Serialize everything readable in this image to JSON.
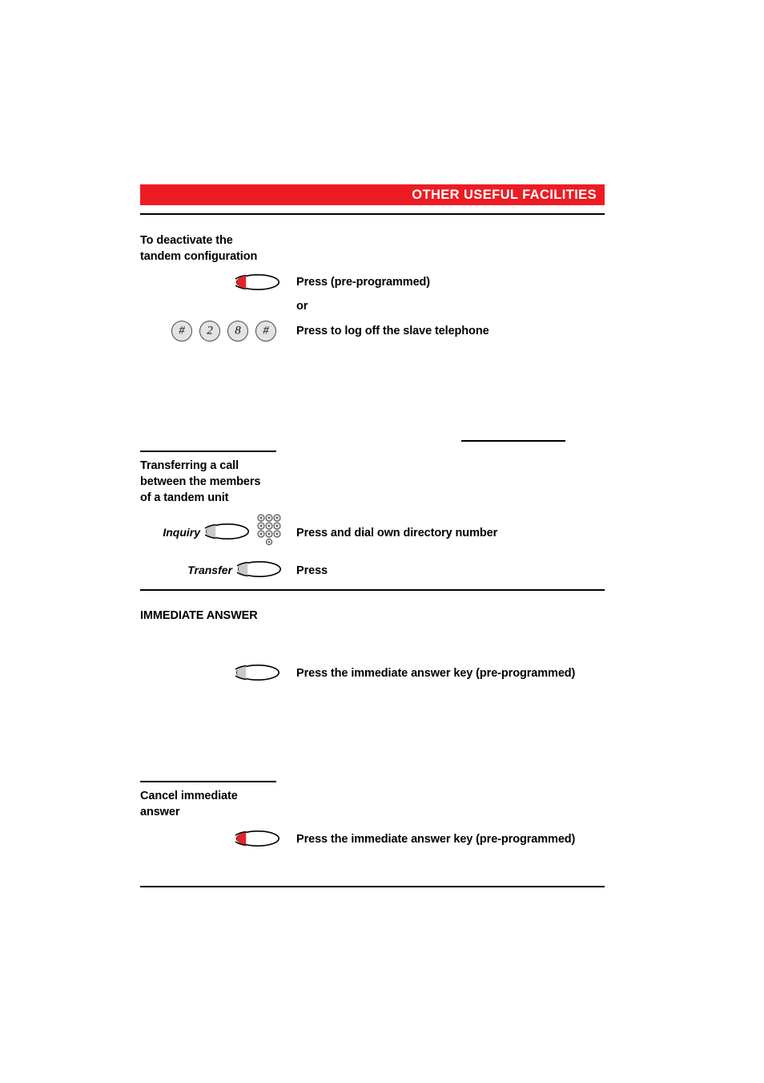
{
  "header": {
    "title": "OTHER USEFUL FACILITIES",
    "banner_color": "#ED1C24",
    "banner_text_color": "#FFFFFF"
  },
  "sections": [
    {
      "id": "deactivate-tandem",
      "heading": "To deactivate the\ntandem configuration",
      "steps": [
        {
          "icon": "function-key-red",
          "instruction": "Press (pre-programmed)"
        },
        {
          "icon": "none",
          "instruction": "or"
        },
        {
          "icon": "keypad-digits",
          "keys": [
            "#",
            "2",
            "8",
            "#"
          ],
          "instruction": "Press to log off the slave telephone"
        }
      ]
    },
    {
      "id": "transfer-between-tandem",
      "heading": "Transferring a call\nbetween the members\nof a tandem unit",
      "steps": [
        {
          "icon": "function-key-gray",
          "key_label": "Inquiry",
          "extra_icon": "dialpad-icon",
          "instruction": "Press and dial own directory number"
        },
        {
          "icon": "function-key-gray",
          "key_label": "Transfer",
          "instruction": "Press"
        }
      ]
    },
    {
      "id": "immediate-answer",
      "heading": "IMMEDIATE ANSWER",
      "steps": [
        {
          "icon": "function-key-gray",
          "instruction": "Press the immediate answer key (pre-programmed)"
        }
      ]
    },
    {
      "id": "cancel-immediate-answer",
      "heading": "Cancel immediate\nanswer",
      "steps": [
        {
          "icon": "function-key-red",
          "instruction": "Press the immediate answer key (pre-programmed)"
        }
      ]
    }
  ],
  "keys": {
    "hash_1": "#",
    "digit_2": "2",
    "digit_8": "8",
    "hash_2": "#",
    "inquiry_label": "Inquiry",
    "transfer_label": "Transfer"
  },
  "text": {
    "press_preprogrammed": "Press (pre-programmed)",
    "or": "or",
    "press_log_off": "Press to log off the slave telephone",
    "press_dial_own": "Press and dial own directory number",
    "press": "Press",
    "press_immediate_1": "Press the immediate answer key (pre-programmed)",
    "press_immediate_2": "Press the immediate answer key (pre-programmed)"
  },
  "headings": {
    "deactivate": "To deactivate the\ntandem configuration",
    "transferring": "Transferring a call\nbetween the members\nof a tandem unit",
    "immediate_answer": "IMMEDIATE ANSWER",
    "cancel_immediate": "Cancel immediate\nanswer"
  }
}
